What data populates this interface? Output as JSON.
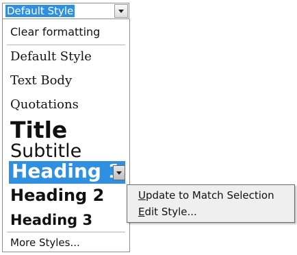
{
  "style_box": {
    "current_value": "Default Style"
  },
  "style_list": {
    "items": [
      {
        "label": "Clear formatting"
      },
      {
        "label": "Default Style"
      },
      {
        "label": "Text Body"
      },
      {
        "label": "Quotations"
      },
      {
        "label": "Title"
      },
      {
        "label": "Subtitle"
      },
      {
        "label": "Heading 1"
      },
      {
        "label": "Heading 2"
      },
      {
        "label": "Heading 3"
      }
    ],
    "more_label": "More Styles...",
    "highlight_color": "#2f8fe0"
  },
  "context_menu": {
    "items": [
      {
        "mnemonic": "U",
        "rest": "pdate to Match Selection"
      },
      {
        "mnemonic": "E",
        "rest": "dit Style..."
      }
    ]
  }
}
